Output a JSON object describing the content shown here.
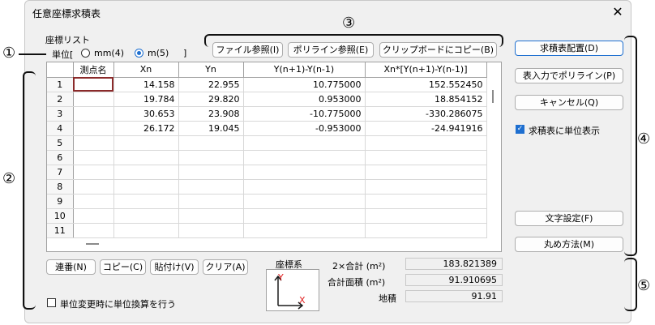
{
  "window": {
    "title": "任意座標求積表",
    "close_glyph": "✕"
  },
  "markers": {
    "m1": "①",
    "m2": "②",
    "m3": "③",
    "m4": "④",
    "m5": "⑤"
  },
  "coord_list": {
    "group_label": "座標リスト",
    "unit_label": "単位[",
    "unit_close": "]",
    "unit_options": [
      {
        "label": "mm(4)",
        "selected": false
      },
      {
        "label": "m(5)",
        "selected": true
      }
    ]
  },
  "top_buttons": {
    "file_ref": "ファイル参照(I)",
    "polyline_ref": "ポリライン参照(E)",
    "clipboard_copy": "クリップボードにコピー(B)"
  },
  "table": {
    "headers": [
      "測点名",
      "Xn",
      "Yn",
      "Y(n+1)-Y(n-1)",
      "Xn*[Y(n+1)-Y(n-1)]"
    ],
    "rows": [
      {
        "no": "1",
        "name": "",
        "xn": "14.158",
        "yn": "22.955",
        "dy": "10.775000",
        "prod": "152.552450"
      },
      {
        "no": "2",
        "name": "",
        "xn": "19.784",
        "yn": "29.820",
        "dy": "0.953000",
        "prod": "18.854152"
      },
      {
        "no": "3",
        "name": "",
        "xn": "30.653",
        "yn": "23.908",
        "dy": "-10.775000",
        "prod": "-330.286075"
      },
      {
        "no": "4",
        "name": "",
        "xn": "26.172",
        "yn": "19.045",
        "dy": "-0.953000",
        "prod": "-24.941916"
      },
      {
        "no": "5",
        "name": "",
        "xn": "",
        "yn": "",
        "dy": "",
        "prod": ""
      },
      {
        "no": "6",
        "name": "",
        "xn": "",
        "yn": "",
        "dy": "",
        "prod": ""
      },
      {
        "no": "7",
        "name": "",
        "xn": "",
        "yn": "",
        "dy": "",
        "prod": ""
      },
      {
        "no": "8",
        "name": "",
        "xn": "",
        "yn": "",
        "dy": "",
        "prod": ""
      },
      {
        "no": "9",
        "name": "",
        "xn": "",
        "yn": "",
        "dy": "",
        "prod": ""
      },
      {
        "no": "10",
        "name": "",
        "xn": "",
        "yn": "",
        "dy": "",
        "prod": ""
      },
      {
        "no": "11",
        "name": "",
        "xn": "",
        "yn": "",
        "dy": "",
        "prod": ""
      }
    ]
  },
  "bottom_buttons": {
    "serial": "連番(N)",
    "copy": "コピー(C)",
    "paste": "貼付け(V)",
    "clear": "クリア(A)"
  },
  "unit_convert_checkbox": {
    "label": "単位変更時に単位換算を行う",
    "checked": false
  },
  "coord_system": {
    "label": "座標系",
    "x_axis": "X",
    "y_axis": "Y"
  },
  "results": {
    "double_sum_label": "2×合計 (m²)",
    "double_sum_value": "183.821389",
    "area_total_label": "合計面積 (m²)",
    "area_total_value": "91.910695",
    "lot_label": "地積",
    "lot_value": "91.91"
  },
  "right_buttons": {
    "place_table": "求積表配置(D)",
    "polyline_from_table": "表入力でポリライン(P)",
    "cancel": "キャンセル(Q)",
    "font_settings": "文字設定(F)",
    "rounding": "丸め方法(M)"
  },
  "unit_display_checkbox": {
    "label": "求積表に単位表示",
    "checked": true
  },
  "colors": {
    "accent": "#1e6fd0",
    "selected_cell": "#8b2a2a",
    "axis_x": "#e02020",
    "axis_y": "#e02020"
  }
}
